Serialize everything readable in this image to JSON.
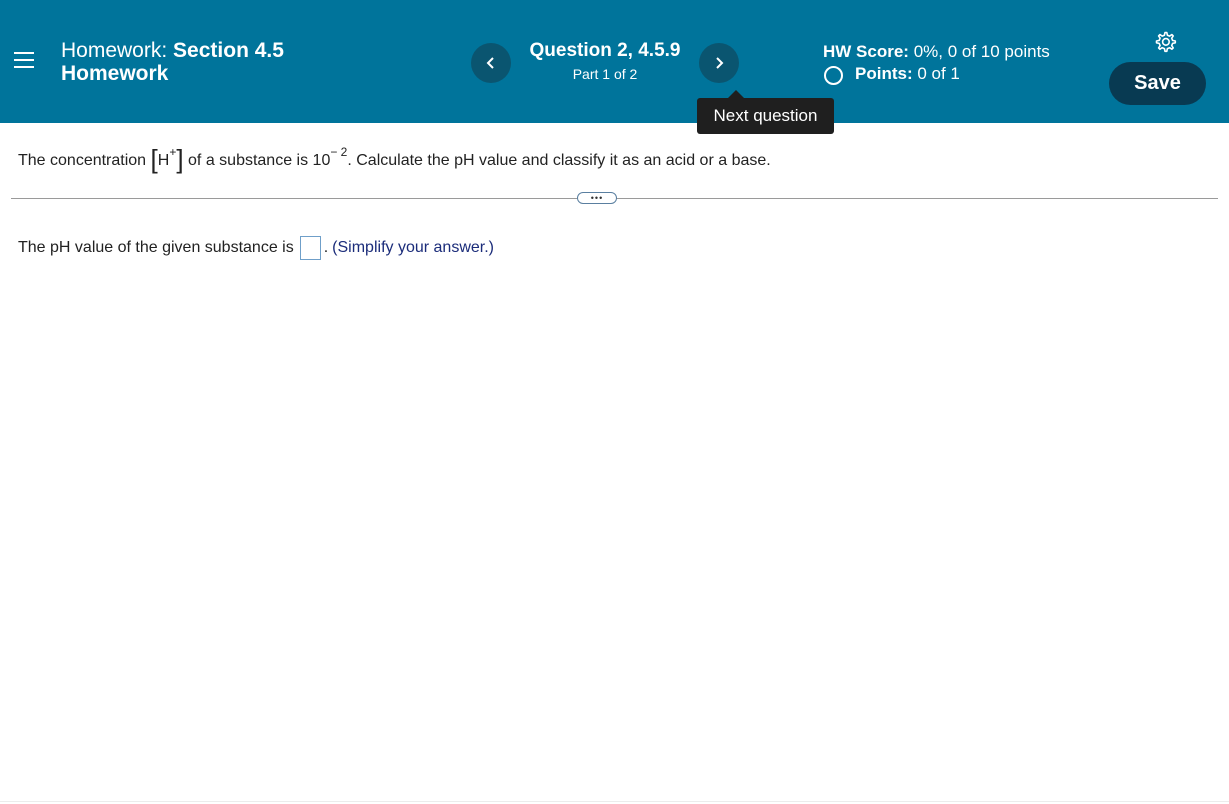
{
  "header": {
    "homework_label": "Homework:",
    "section_title": "Section 4.5",
    "section_title_line2": "Homework",
    "question_title": "Question 2, 4.5.9",
    "question_part": "Part 1 of 2",
    "hw_score_label": "HW Score:",
    "hw_score_value": "0%, 0 of 10 points",
    "points_label": "Points:",
    "points_value": "0 of 1",
    "save_label": "Save",
    "next_tooltip": "Next question",
    "icons": [
      "menu-icon",
      "chevron-left-icon",
      "chevron-right-icon",
      "gear-icon",
      "circle-icon"
    ]
  },
  "question": {
    "text_start": "The concentration",
    "species": "H",
    "species_charge": "+",
    "text_middle": "of a substance is 10",
    "exponent": "− 2",
    "text_end": ". Calculate the pH value and classify it as an acid or a base.",
    "more_label": "•••"
  },
  "answer": {
    "prompt": "The pH value of the given substance is",
    "input_value": "",
    "after_box": ".",
    "hint": "(Simplify your answer.)"
  },
  "colors": {
    "header_bg": "#00749b",
    "nav_button_bg": "#0a5570",
    "save_button_bg": "#083a52",
    "tooltip_bg": "#1f1f1f",
    "hint_text": "#1b2c7a"
  }
}
